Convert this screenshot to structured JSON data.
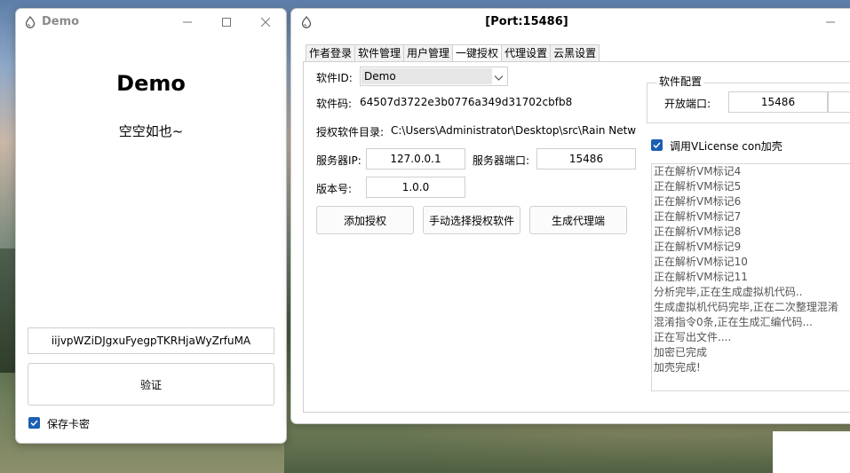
{
  "demo_window": {
    "title": "Demo",
    "heading": "Demo",
    "subtitle": "空空如也~",
    "card_key": "iijvpWZiDJgxuFyegpTKRHjaWyZrfuMA",
    "verify_label": "验证",
    "save_key_label": "保存卡密",
    "save_key_checked": true
  },
  "main_window": {
    "title": "[Port:15486]",
    "tabs": [
      "作者登录",
      "软件管理",
      "用户管理",
      "一键授权",
      "代理设置",
      "云黑设置"
    ],
    "active_tab": 3,
    "form": {
      "software_id_label": "软件ID:",
      "software_id_value": "Demo",
      "software_code_label": "软件码:",
      "software_code_value": "64507d3722e3b0776a349d31702cbfb8",
      "auth_dir_label": "授权软件目录:",
      "auth_dir_value": "C:\\Users\\Administrator\\Desktop\\src\\Rain Netwo",
      "server_ip_label": "服务器IP:",
      "server_ip_value": "127.0.0.1",
      "server_port_label": "服务器端口:",
      "server_port_value": "15486",
      "version_label": "版本号:",
      "version_value": "1.0.0"
    },
    "buttons": {
      "add_auth": "添加授权",
      "select_software": "手动选择授权软件",
      "generate_proxy": "生成代理端"
    },
    "config": {
      "group_title": "软件配置",
      "open_port_label": "开放端口:",
      "open_port_value": "15486",
      "vlicense_label": "调用VLicense con加壳",
      "vlicense_checked": true
    },
    "log_lines": [
      "正在解析VM标记4",
      "正在解析VM标记5",
      "正在解析VM标记6",
      "正在解析VM标记7",
      "正在解析VM标记8",
      "正在解析VM标记9",
      "正在解析VM标记10",
      "正在解析VM标记11",
      "分析完毕,正在生成虚拟机代码..",
      "生成虚拟机代码完毕,正在二次整理混淆",
      "混淆指令0条,正在生成汇编代码...",
      "正在写出文件....",
      "加密已完成",
      "加壳完成!"
    ]
  }
}
